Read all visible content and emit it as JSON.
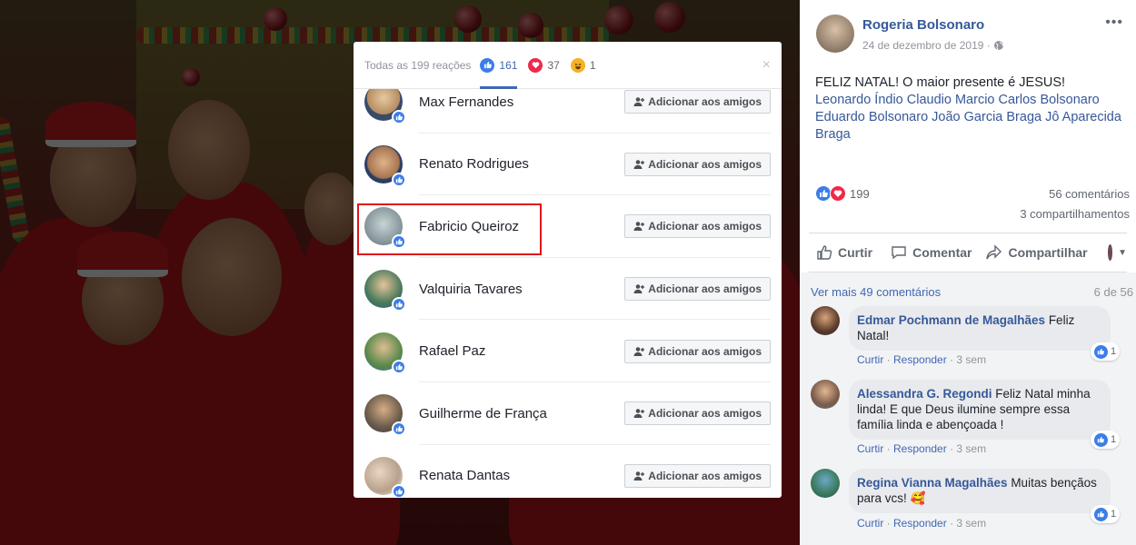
{
  "modal": {
    "all_label": "Todas as 199 reações",
    "tabs": [
      {
        "icon": "like-reaction-icon",
        "count": "161"
      },
      {
        "icon": "love-reaction-icon",
        "count": "37"
      },
      {
        "icon": "haha-reaction-icon",
        "count": "1"
      }
    ],
    "close": "×",
    "people": [
      {
        "name": "Max Fernandes"
      },
      {
        "name": "Renato Rodrigues"
      },
      {
        "name": "Fabricio Queiroz"
      },
      {
        "name": "Valquiria Tavares"
      },
      {
        "name": "Rafael Paz"
      },
      {
        "name": "Guilherme de França"
      },
      {
        "name": "Renata Dantas"
      }
    ],
    "add_friend_label": "Adicionar aos amigos"
  },
  "post": {
    "author": "Rogeria Bolsonaro",
    "date": "24 de dezembro de 2019 · ",
    "text": "FELIZ NATAL! O maior presente é JESUS!",
    "tags": "Leonardo Índio Claudio Marcio Carlos Bolsonaro Eduardo Bolsonaro João Garcia Braga Jô Aparecida Braga",
    "reactions_count": "199",
    "comments_count": "56 comentários",
    "shares_count": "3 compartilhamentos",
    "actions": {
      "like": "Curtir",
      "comment": "Comentar",
      "share": "Compartilhar"
    }
  },
  "comments_section": {
    "see_more": "Ver mais 49 comentários",
    "count": "6 de 56",
    "items": [
      {
        "author": "Edmar Pochmann de Magalhães",
        "text": " Feliz Natal!",
        "like": "Curtir",
        "reply": "Responder",
        "time": "3 sem",
        "reactions": "1"
      },
      {
        "author": "Alessandra G. Regondi",
        "text": " Feliz Natal minha linda! E que Deus ilumine sempre essa família linda e abençoada !",
        "like": "Curtir",
        "reply": "Responder",
        "time": "3 sem",
        "reactions": "1"
      },
      {
        "author": "Regina Vianna Magalhães",
        "text": " Muitas bençãos para vcs! 🥰",
        "like": "Curtir",
        "reply": "Responder",
        "time": "3 sem",
        "reactions": "1"
      }
    ]
  },
  "colors": {
    "link": "#365899",
    "accent": "#4267b2",
    "highlight": "#e0141c",
    "like": "#3b7de9",
    "love": "#f0284a"
  }
}
